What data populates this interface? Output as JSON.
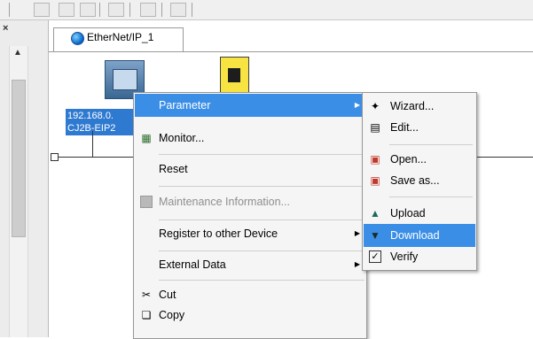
{
  "workspace": {
    "tab_label": "EtherNet/IP_1",
    "device_label_line1": "192.168.0.",
    "device_label_line2": "CJ2B-EIP2"
  },
  "left_pane": {
    "close_glyph": "×",
    "scroll_up_glyph": "▲"
  },
  "context_menu": {
    "items": [
      {
        "label": "Parameter",
        "highlighted": true,
        "submenu": true
      },
      {
        "label": "Monitor...",
        "icon": "monitor-icon"
      },
      {
        "label": "Reset"
      },
      {
        "label": "Maintenance Information...",
        "disabled": true,
        "icon": "maintenance-icon"
      },
      {
        "label": "Register to other Device",
        "submenu": true
      },
      {
        "label": "External Data",
        "submenu": true
      },
      {
        "label": "Cut",
        "icon": "scissors-icon"
      },
      {
        "label": "Copy",
        "icon": "copy-icon"
      }
    ]
  },
  "submenu": {
    "items": [
      {
        "label": "Wizard...",
        "icon": "wizard-icon"
      },
      {
        "label": "Edit...",
        "icon": "edit-icon"
      },
      {
        "label": "Open...",
        "icon": "open-icon"
      },
      {
        "label": "Save as...",
        "icon": "save-icon"
      },
      {
        "label": "Upload",
        "icon": "upload-icon"
      },
      {
        "label": "Download",
        "icon": "download-icon",
        "highlighted": true
      },
      {
        "label": "Verify",
        "icon": "verify-icon"
      }
    ]
  },
  "colors": {
    "highlight": "#3b8ee6",
    "device_label_bg": "#2f7ad1"
  }
}
